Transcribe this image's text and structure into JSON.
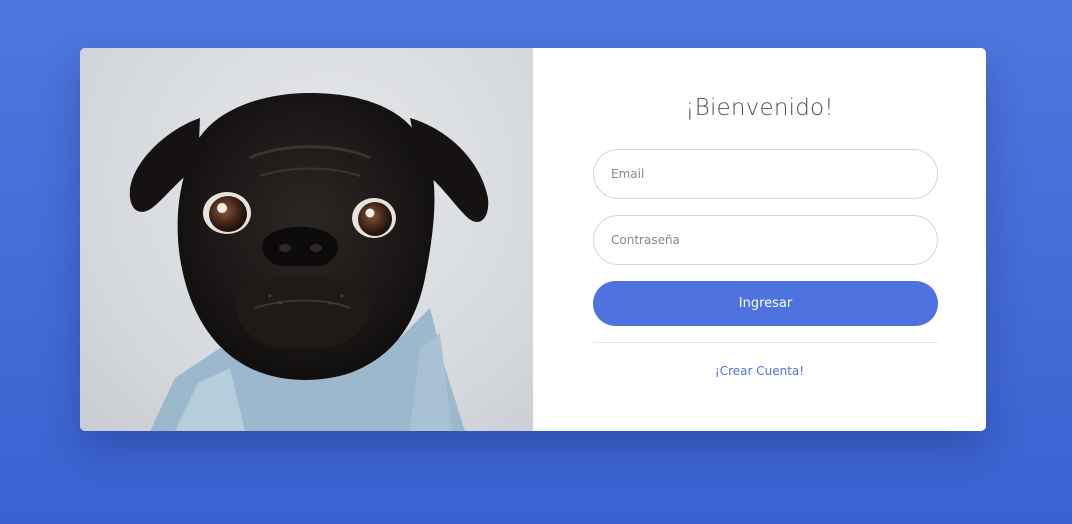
{
  "form": {
    "title": "¡Bienvenido!",
    "email_placeholder": "Email",
    "password_placeholder": "Contraseña",
    "login_label": "Ingresar",
    "create_account_label": "¡Crear Cuenta!"
  },
  "colors": {
    "background": "#4e73df",
    "button": "#4e73df",
    "link": "#4e73df",
    "card": "#ffffff"
  },
  "image": {
    "subject": "black pug wearing denim jacket"
  }
}
